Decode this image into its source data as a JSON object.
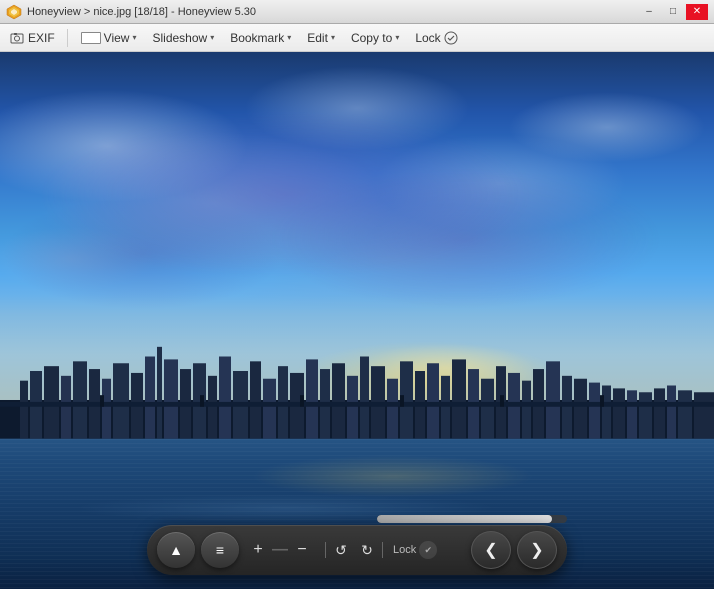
{
  "titleBar": {
    "appName": "Honeyview",
    "separator1": ">",
    "fileName": "nice.jpg [18/18]",
    "separator2": "-",
    "appNameFull": "Honeyview 5.30",
    "fullTitle": "Honeyview > nice.jpg [18/18] - Honeyview 5.30",
    "minimizeLabel": "–",
    "maximizeLabel": "□",
    "closeLabel": "✕"
  },
  "menuBar": {
    "exifLabel": "EXIF",
    "viewLabel": "View",
    "slideshowLabel": "Slideshow",
    "bookmarkLabel": "Bookmark",
    "editLabel": "Edit",
    "copyLabel": "Copy to",
    "lockLabel": "Lock",
    "dropdownArrow": "▾"
  },
  "toolbar": {
    "ejectSymbol": "▲",
    "menuSymbol": "≡",
    "zoomIn": "+",
    "zoomOut": "−",
    "rotateCCW": "↺",
    "rotateCW": "↻",
    "lockLabel": "Lock",
    "lockCheckSymbol": "✔",
    "prevLabel": "❮",
    "nextLabel": "❯"
  },
  "image": {
    "altText": "Seoul skyline at sunset over Han River"
  },
  "colors": {
    "accent": "#4a9edd",
    "titleBg": "#d8d8d8",
    "menuBg": "#ebebeb",
    "toolbarBg": "#2a2a2a",
    "closeBtn": "#e81123"
  }
}
